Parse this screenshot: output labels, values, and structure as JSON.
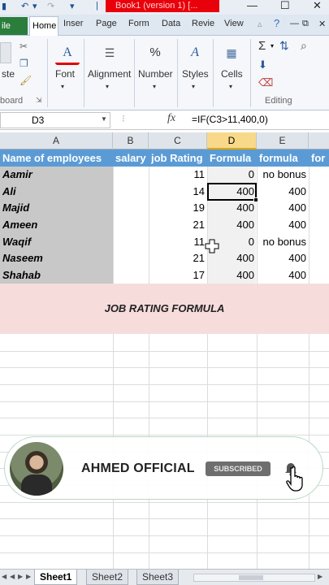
{
  "titlebar": {
    "title": "Book1 (version 1) [..."
  },
  "tabs": {
    "file": "ile",
    "home": "Home",
    "insert": "Inser",
    "page": "Page",
    "formulas": "Form",
    "data": "Data",
    "review": "Revie",
    "view": "View"
  },
  "ribbon": {
    "paste": "ste",
    "clipboard_group": "board",
    "font": "Font",
    "alignment": "Alignment",
    "number": "Number",
    "number_icon": "%",
    "styles": "Styles",
    "cells": "Cells",
    "editing_group": "Editing"
  },
  "formula_bar": {
    "name_box": "D3",
    "fx": "fx",
    "formula": "=IF(C3>11,400,0)"
  },
  "columns": [
    "A",
    "B",
    "C",
    "D",
    "E"
  ],
  "sheet": {
    "headers": [
      "Name of employees",
      "salary",
      "job Rating",
      "Formula",
      "formula",
      "for"
    ],
    "rows": [
      {
        "name": "Aamir",
        "rating": "11",
        "formula": "0",
        "bonus": "no bonus"
      },
      {
        "name": "Ali",
        "rating": "14",
        "formula": "400",
        "bonus": "400"
      },
      {
        "name": "Majid",
        "rating": "19",
        "formula": "400",
        "bonus": "400"
      },
      {
        "name": "Ameen",
        "rating": "21",
        "formula": "400",
        "bonus": "400"
      },
      {
        "name": "Waqif",
        "rating": "11",
        "formula": "0",
        "bonus": "no bonus"
      },
      {
        "name": "Naseem",
        "rating": "21",
        "formula": "400",
        "bonus": "400"
      },
      {
        "name": "Shahab",
        "rating": "17",
        "formula": "400",
        "bonus": "400"
      }
    ],
    "banner": "JOB RATING FORMULA"
  },
  "overlay": {
    "channel": "AHMED OFFICIAL",
    "subscribe": "SUBSCRIBED"
  },
  "sheet_tabs": [
    "Sheet1",
    "Sheet2",
    "Sheet3"
  ],
  "colors": {
    "header_blue": "#5b9bd5",
    "file_green": "#2a7d3b",
    "title_red": "#e8000b",
    "banner_pink": "#f7dcdc"
  }
}
